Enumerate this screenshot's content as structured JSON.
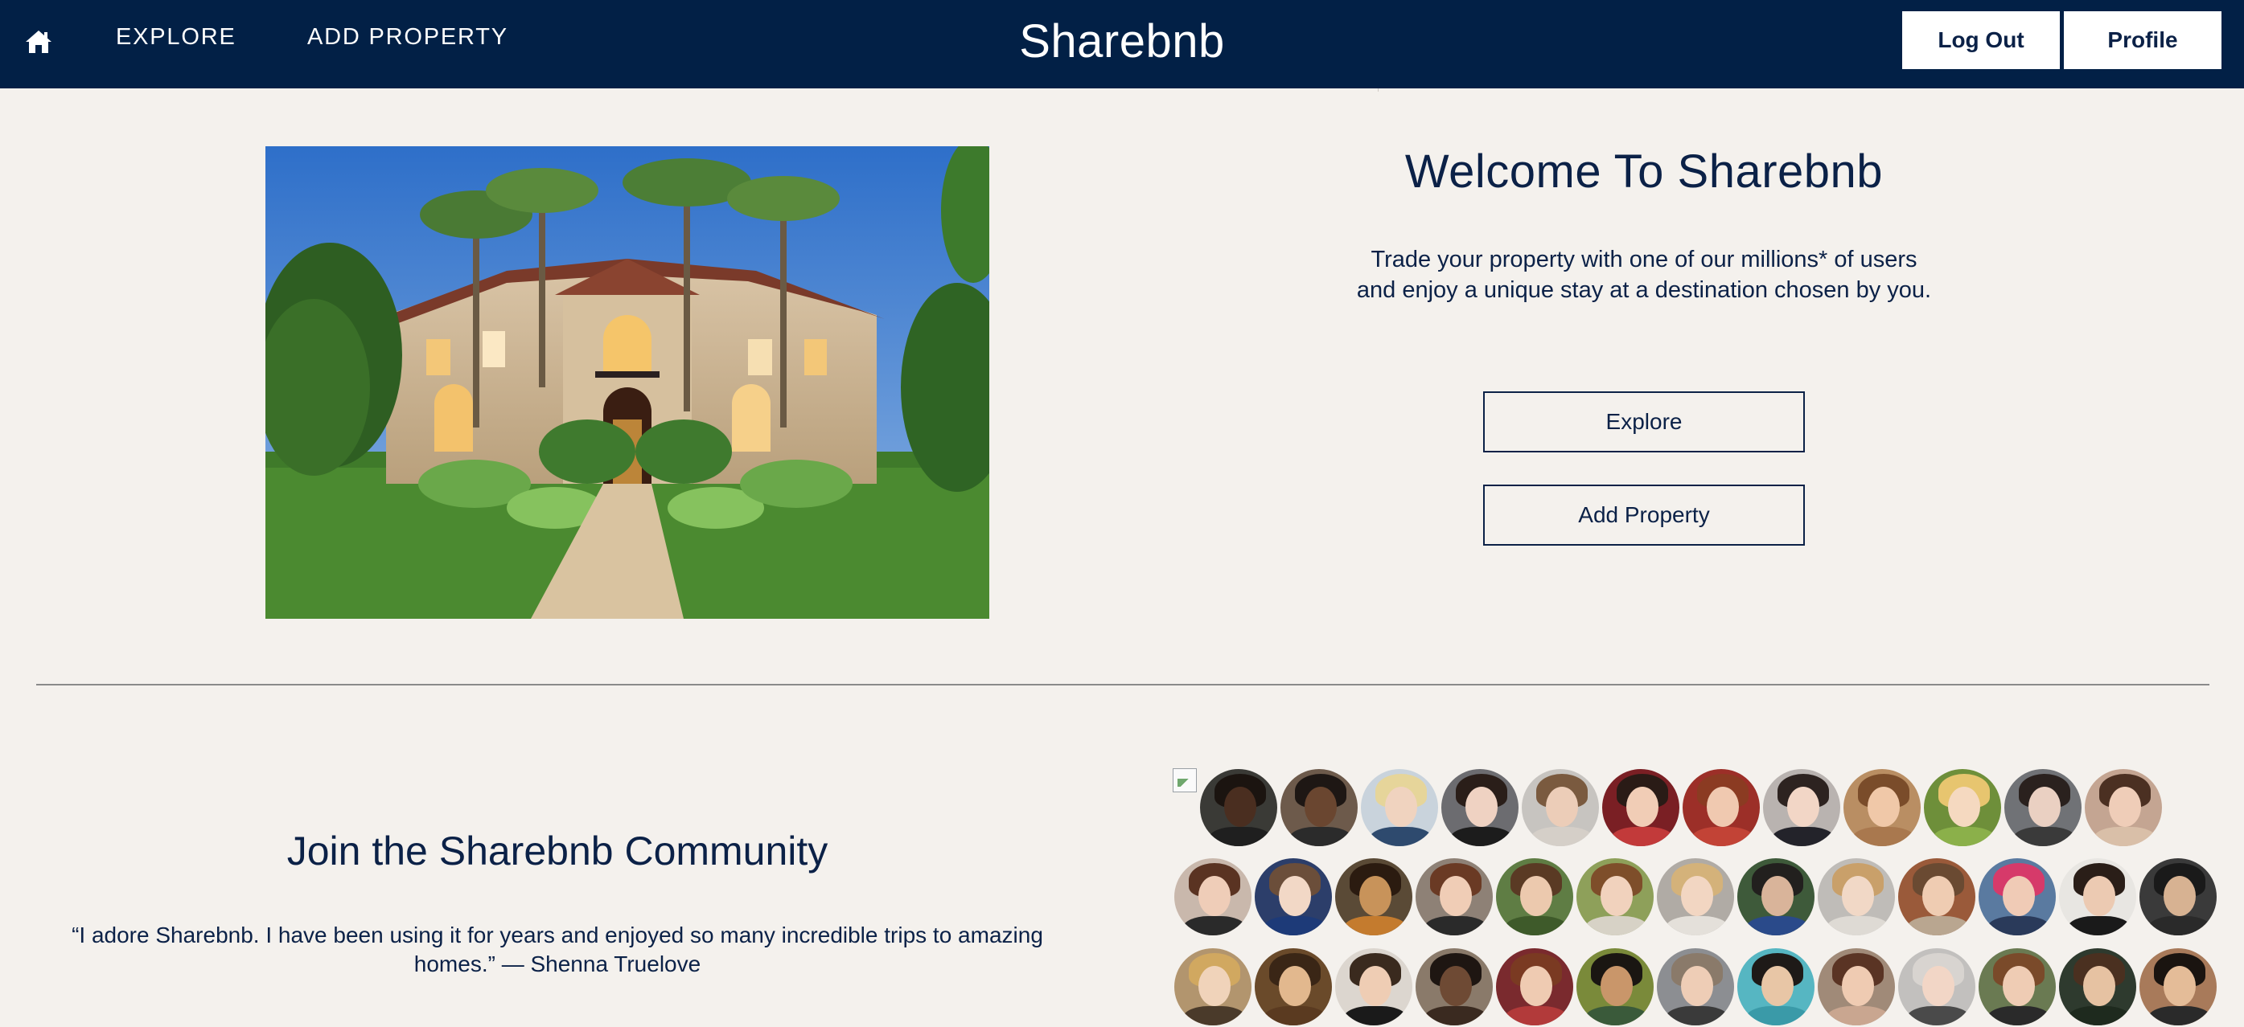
{
  "nav": {
    "home_icon": "home-icon",
    "explore_label": "EXPLORE",
    "add_property_label": "ADD PROPERTY",
    "brand": "Sharebnb",
    "logout_label": "Log Out",
    "profile_label": "Profile"
  },
  "hero": {
    "title": "Welcome To Sharebnb",
    "text": "Trade your property with one of our millions* of users and enjoy a unique stay at a destination chosen by you.",
    "explore_button": "Explore",
    "add_property_button": "Add Property"
  },
  "community": {
    "title": "Join the Sharebnb Community",
    "testimonial": "“I adore Sharebnb. I have been using it for years and enjoyed so many incredible trips to amazing homes.” — Shenna Truelove"
  },
  "colors": {
    "navy": "#022046",
    "background": "#f4f1ed",
    "text": "#0b2147"
  },
  "avatars": [
    {
      "bg": "#3a3a36",
      "skin": "#4a2e20",
      "hair": "#1b1410",
      "shirt": "#1f1f1f"
    },
    {
      "bg": "#6d5a4b",
      "skin": "#6a4630",
      "hair": "#1e1714",
      "shirt": "#2b2b2b"
    },
    {
      "bg": "#c9d3dc",
      "skin": "#f0d3bf",
      "hair": "#e6d59a",
      "shirt": "#2e4a6e"
    },
    {
      "bg": "#6c6c70",
      "skin": "#efd2c2",
      "hair": "#2a1e19",
      "shirt": "#1c1c1c"
    },
    {
      "bg": "#c7c4c0",
      "skin": "#eccdb8",
      "hair": "#7a5a3f",
      "shirt": "#d5cfc8"
    },
    {
      "bg": "#7a1f24",
      "skin": "#f1cdb6",
      "hair": "#2a1b16",
      "shirt": "#c23a3a"
    },
    {
      "bg": "#9c2f28",
      "skin": "#f0c9b0",
      "hair": "#8b3b22",
      "shirt": "#c24336"
    },
    {
      "bg": "#b9b3b0",
      "skin": "#f2d6c6",
      "hair": "#2d2320",
      "shirt": "#23232a"
    },
    {
      "bg": "#b98e63",
      "skin": "#f0c8a8",
      "hair": "#7a4c2a",
      "shirt": "#a9784e"
    },
    {
      "bg": "#6e8f3a",
      "skin": "#f5d9c0",
      "hair": "#e7c56f",
      "shirt": "#8bb04a"
    },
    {
      "bg": "#707276",
      "skin": "#ead0c2",
      "hair": "#2a211e",
      "shirt": "#3a3a3a"
    },
    {
      "bg": "#c4a592",
      "skin": "#efcdb8",
      "hair": "#4b3022",
      "shirt": "#d9bfa8"
    },
    {
      "bg": "#c9b8ac",
      "skin": "#efcdb8",
      "hair": "#5a3322",
      "shirt": "#2a2a2a"
    },
    {
      "bg": "#2c3e6a",
      "skin": "#f2d8c6",
      "hair": "#6b4e3a",
      "shirt": "#1d3a78"
    },
    {
      "bg": "#5a4a36",
      "skin": "#c8935a",
      "hair": "#2b1b10",
      "shirt": "#c47b2e"
    },
    {
      "bg": "#8e8176",
      "skin": "#f0cdb6",
      "hair": "#6a3a24",
      "shirt": "#2a2a2a"
    },
    {
      "bg": "#5f7d44",
      "skin": "#ecc9ae",
      "hair": "#5a3a24",
      "shirt": "#3e5a2a"
    },
    {
      "bg": "#8ea05a",
      "skin": "#f1d2bd",
      "hair": "#7e4e2a",
      "shirt": "#d7d2c6"
    },
    {
      "bg": "#b0aba5",
      "skin": "#f2d6c2",
      "hair": "#d4b27a",
      "shirt": "#e4e0da"
    },
    {
      "bg": "#3e5a3a",
      "skin": "#d9b49a",
      "hair": "#22201e",
      "shirt": "#2a4a8a"
    },
    {
      "bg": "#bfbcb8",
      "skin": "#f1d8c6",
      "hair": "#c9a06a",
      "shirt": "#dedad4"
    },
    {
      "bg": "#9a5a3a",
      "skin": "#efccb2",
      "hair": "#6a4a32",
      "shirt": "#b9a690"
    },
    {
      "bg": "#5a7aa0",
      "skin": "#f0cbb6",
      "hair": "#d63a6a",
      "shirt": "#2a3a5a"
    },
    {
      "bg": "#e8e6e2",
      "skin": "#eccab2",
      "hair": "#2a1e18",
      "shirt": "#1a1a1a"
    },
    {
      "bg": "#3a3a3a",
      "skin": "#d7b292",
      "hair": "#1a1a1a",
      "shirt": "#2a2a2a"
    },
    {
      "bg": "#b2956e",
      "skin": "#f0d3ba",
      "hair": "#d1a860",
      "shirt": "#4a3a2a"
    },
    {
      "bg": "#6a4a2a",
      "skin": "#e2b88e",
      "hair": "#3a2616",
      "shirt": "#5a3a20"
    },
    {
      "bg": "#dcd6cf",
      "skin": "#efcdb4",
      "hair": "#3a2a1e",
      "shirt": "#1a1a1a"
    },
    {
      "bg": "#8a7a6a",
      "skin": "#6e4a34",
      "hair": "#1e1612",
      "shirt": "#3a2a20"
    },
    {
      "bg": "#7a2a2e",
      "skin": "#efcbb2",
      "hair": "#7a3a22",
      "shirt": "#b23a3a"
    },
    {
      "bg": "#7a8a3a",
      "skin": "#c9966a",
      "hair": "#1a1612",
      "shirt": "#3a5a3a"
    },
    {
      "bg": "#8c8e92",
      "skin": "#eecdb6",
      "hair": "#8a7a6a",
      "shirt": "#3a3a3a"
    },
    {
      "bg": "#56b6c2",
      "skin": "#e8c6a6",
      "hair": "#1e1a18",
      "shirt": "#3a9aa8"
    },
    {
      "bg": "#a08a78",
      "skin": "#efcbb2",
      "hair": "#5a3424",
      "shirt": "#c9a690"
    },
    {
      "bg": "#c2c0be",
      "skin": "#f2d6c6",
      "hair": "#d8d4d0",
      "shirt": "#4a4a4a"
    },
    {
      "bg": "#6a7a52",
      "skin": "#efccb4",
      "hair": "#7a4a2a",
      "shirt": "#2a2a2a"
    },
    {
      "bg": "#2e3a2e",
      "skin": "#e6c2a2",
      "hair": "#4a3020",
      "shirt": "#1e2a1e"
    },
    {
      "bg": "#a87a5a",
      "skin": "#e4bc98",
      "hair": "#1a1410",
      "shirt": "#2a2a2a"
    }
  ]
}
